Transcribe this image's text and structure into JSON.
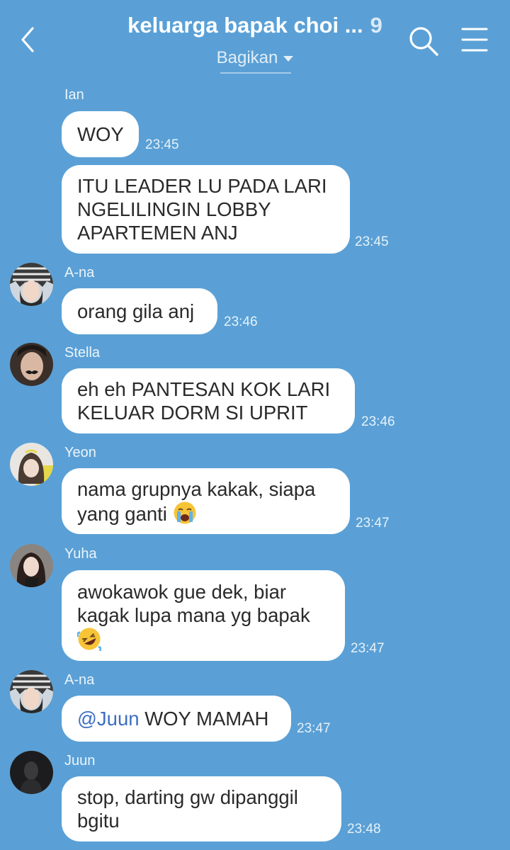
{
  "colors": {
    "background": "#5aa0d6",
    "bubble": "#ffffff",
    "mention": "#3d6fc2"
  },
  "header": {
    "title": "keluarga bapak choi ...",
    "member_count": "9",
    "share_label": "Bagikan",
    "icons": {
      "back": "chevron-left-icon",
      "search": "search-icon",
      "menu": "menu-icon"
    }
  },
  "messages": [
    {
      "sender": "Ian",
      "text": "WOY",
      "time": "23:45"
    },
    {
      "text": "ITU LEADER LU PADA LARI\nNGELILINGIN LOBBY\nAPARTEMEN ANJ",
      "time": "23:45"
    },
    {
      "sender": "A-na",
      "text": "orang gila anj",
      "time": "23:46"
    },
    {
      "sender": "Stella",
      "text": "eh eh PANTESAN KOK LARI\nKELUAR DORM SI UPRIT",
      "time": "23:46"
    },
    {
      "sender": "Yeon",
      "text": "nama grupnya kakak, siapa\nyang ganti",
      "emoji": "loudly-crying-face",
      "time": "23:47"
    },
    {
      "sender": "Yuha",
      "text": "awokawok gue dek, biar\nkagak lupa mana yg bapak",
      "emoji": "rolling-on-floor-laughing",
      "time": "23:47"
    },
    {
      "sender": "A-na",
      "mention": "@Juun",
      "text": " WOY MAMAH",
      "time": "23:47"
    },
    {
      "sender": "Juun",
      "text": "stop, darting gw dipanggil\nbgitu",
      "time": "23:48"
    }
  ]
}
